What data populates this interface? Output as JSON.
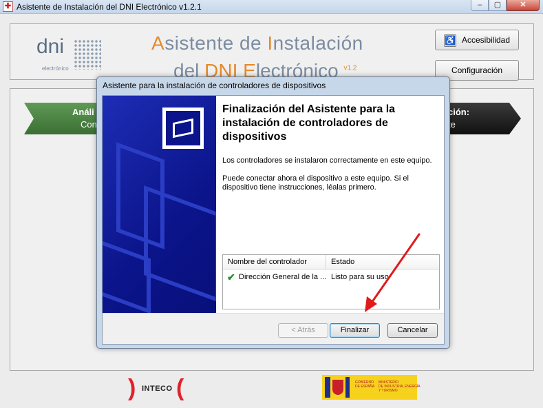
{
  "window": {
    "title": "Asistente de Instalación del DNI Electrónico v1.2.1",
    "icon": "app-icon",
    "controls": {
      "minimize": "–",
      "maximize": "▢",
      "close": "✕"
    }
  },
  "header": {
    "logo_main": "dni",
    "logo_sub": "electrónico",
    "heading_line1_a": "A",
    "heading_line1_b": "sistente de ",
    "heading_line1_c": "I",
    "heading_line1_d": "nstalación",
    "heading_line2_a": "del ",
    "heading_line2_b": "DNI E",
    "heading_line2_c": "lectrónico",
    "version": "v1.2",
    "accessibility_button": "Accesibilidad",
    "config_button": "Configuración"
  },
  "steps": {
    "left_title": "Análi",
    "left_sub": "Con",
    "right_title": "ción:",
    "right_sub": "te"
  },
  "footer": {
    "inteco": "INTECO",
    "gob_text1": "GOBIERNO\nDE ESPAÑA",
    "gob_text2": "MINISTERIO\nDE INDUSTRIA, ENERGÍA\nY TURISMO"
  },
  "dialog": {
    "title": "Asistente para la instalación de controladores de dispositivos",
    "heading": "Finalización del Asistente para la instalación de controladores de dispositivos",
    "paragraph1": "Los controladores se instalaron correctamente en este equipo.",
    "paragraph2": "Puede conectar ahora el dispositivo a este equipo. Si el dispositivo tiene instrucciones, léalas primero.",
    "list": {
      "columns": [
        "Nombre del controlador",
        "Estado"
      ],
      "rows": [
        {
          "name": "Dirección General de la ...",
          "status": "Listo para su uso"
        }
      ]
    },
    "buttons": {
      "back": "< Atrás",
      "finish": "Finalizar",
      "cancel": "Cancelar"
    }
  },
  "colors": {
    "accent_orange": "#e58a2a",
    "wizard_blue": "#0b148a",
    "arrow_red": "#e01a1a",
    "step_green": "#3b6f34"
  }
}
